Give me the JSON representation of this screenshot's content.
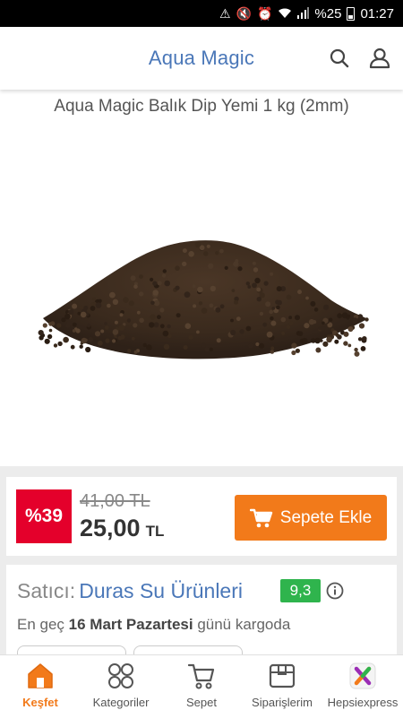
{
  "status_bar": {
    "battery": "%25",
    "time": "01:27"
  },
  "header": {
    "title": "Aqua Magic"
  },
  "product": {
    "title": "Aqua Magic Balık Dip Yemi 1 kg (2mm)"
  },
  "price": {
    "discount": "%39",
    "old_price": "41,00 TL",
    "new_price": "25,00",
    "currency": "TL",
    "add_to_cart_label": "Sepete Ekle"
  },
  "seller": {
    "label": "Satıcı:",
    "name": "Duras Su Ürünleri",
    "rating": "9,3",
    "delivery_prefix": "En geç",
    "delivery_date": "16 Mart Pazartesi",
    "delivery_suffix": "günü kargoda"
  },
  "bottom_nav": [
    {
      "label": "Keşfet",
      "active": true
    },
    {
      "label": "Kategoriler"
    },
    {
      "label": "Sepet"
    },
    {
      "label": "Siparişlerim"
    },
    {
      "label": "Hepsiexpress"
    }
  ],
  "colors": {
    "brand_blue": "#4a77b8",
    "accent_orange": "#f27a1a",
    "discount_red": "#e4002b",
    "rating_green": "#2fb44d"
  }
}
